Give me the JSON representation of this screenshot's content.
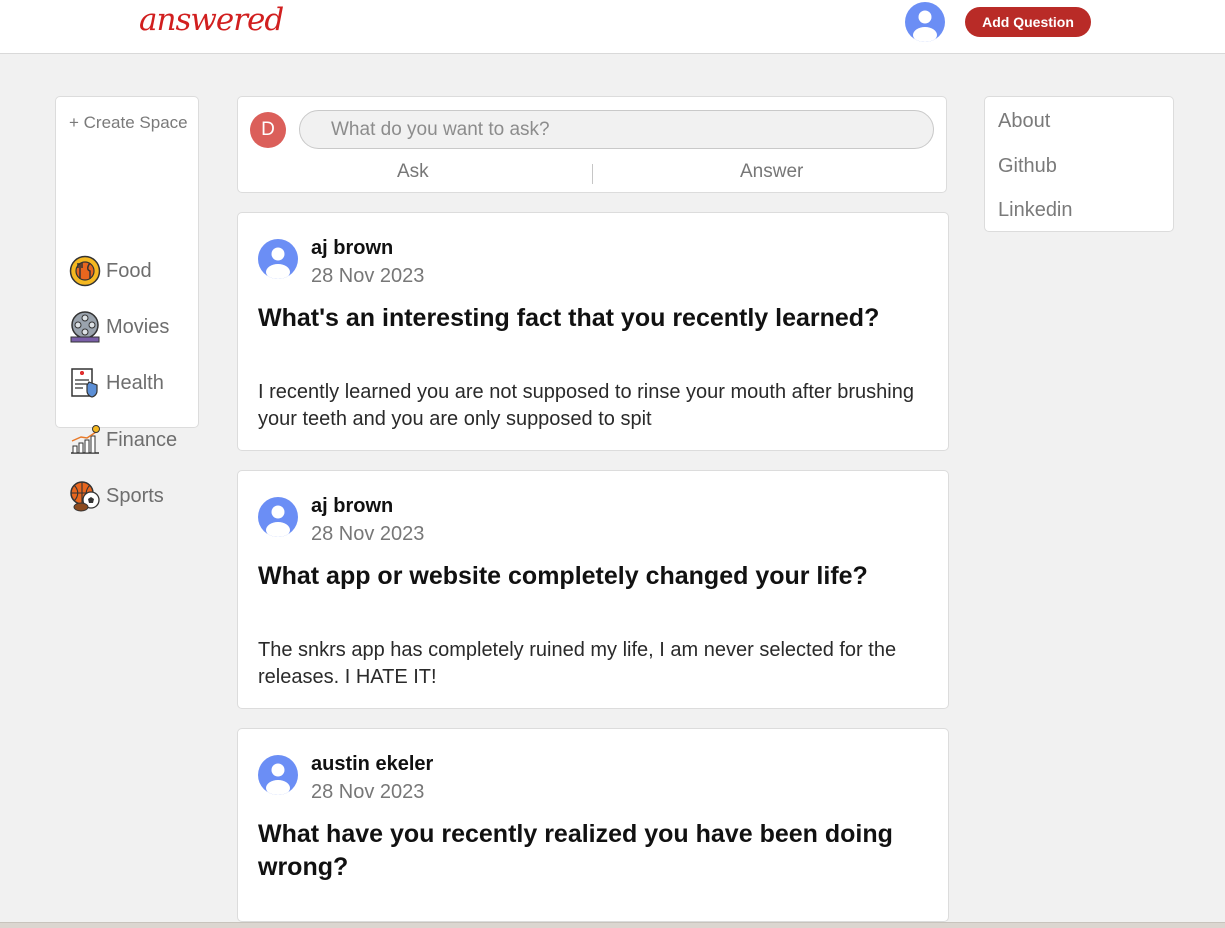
{
  "header": {
    "logo": "answered",
    "avatar_icon": "user-avatar-icon",
    "add_question_label": "Add Question"
  },
  "sidebar": {
    "create_space_label": "+ Create Space",
    "items": [
      {
        "label": "Food",
        "icon": "food-icon"
      },
      {
        "label": "Movies",
        "icon": "film-reel-icon"
      },
      {
        "label": "Health",
        "icon": "health-record-icon"
      },
      {
        "label": "Finance",
        "icon": "finance-chart-icon"
      },
      {
        "label": "Sports",
        "icon": "sports-balls-icon"
      }
    ]
  },
  "askbox": {
    "avatar_letter": "D",
    "placeholder": "What do you want to ask?",
    "ask_tab": "Ask",
    "answer_tab": "Answer"
  },
  "posts": [
    {
      "user": "aj brown",
      "date": "28 Nov 2023",
      "question": "What's an interesting fact that you recently learned?",
      "answer": "I recently learned you are not supposed to rinse your mouth after brushing your teeth and you are only supposed to spit"
    },
    {
      "user": "aj brown",
      "date": "28 Nov 2023",
      "question": "What app or website completely changed your life?",
      "answer": "The snkrs app has completely ruined my life, I am never selected for the releases. I HATE IT!"
    },
    {
      "user": "austin ekeler",
      "date": "28 Nov 2023",
      "question": "What have you recently realized you have been doing wrong?",
      "answer": ""
    }
  ],
  "right_links": [
    "About",
    "Github",
    "Linkedin"
  ],
  "colors": {
    "brand": "#d11f1f",
    "add_button": "#b92b27",
    "avatar_blue": "#6b8ef5",
    "ask_avatar": "#db5f5a",
    "page_bg": "#f1f1f1"
  }
}
